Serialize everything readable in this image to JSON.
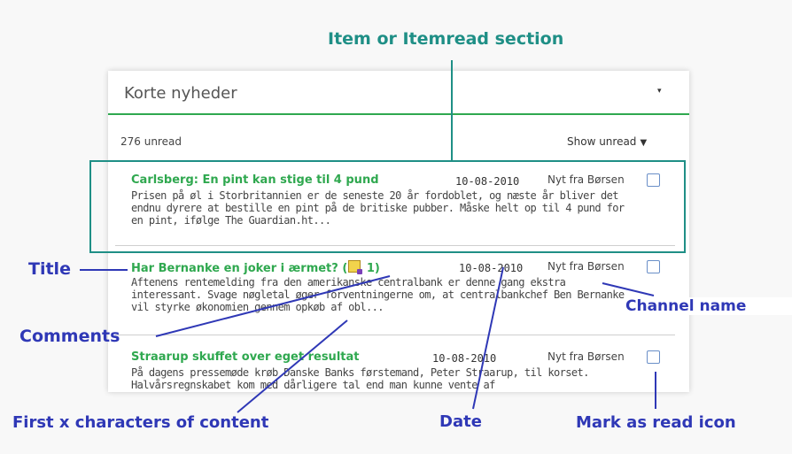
{
  "feed": {
    "title": "Korte nyheder",
    "caret": "▾",
    "unread_count": "276 unread",
    "show_unread": "Show unread",
    "show_unread_caret": "▼"
  },
  "items": [
    {
      "title": "Carlsberg: En pint kan stige til 4 pund",
      "date": "10-08-2010",
      "channel": "Nyt fra Børsen",
      "text": "Prisen på øl i Storbritannien er de seneste 20 år fordoblet, og næste år bliver det endnu dyrere at bestille en pint på de britiske pubber. Måske helt op til 4 pund for en pint, ifølge The Guardian.ht..."
    },
    {
      "title": "Har Bernanke en joker i ærmet?",
      "comment_open": "(",
      "comment_count": "1)",
      "date": "10-08-2010",
      "channel": "Nyt fra Børsen",
      "text": "Aftenens rentemelding fra den amerikanske centralbank er denne gang ekstra interessant. Svage nøgletal øger forventningerne om, at centralbankchef Ben Bernanke vil styrke økonomien gennem opkøb af obl..."
    },
    {
      "title": "Straarup skuffet over eget resultat",
      "date": "10-08-2010",
      "channel": "Nyt fra Børsen",
      "text": "På dagens pressemøde krøb Danske Banks førstemand, Peter Straarup, til korset. Halvårsregnskabet kom med dårligere tal end man kunne vente af"
    }
  ],
  "annotations": {
    "item_section": "Item or Itemread section",
    "title": "Title",
    "comments": "Comments",
    "channel_name": "Channel name",
    "first_chars": "First x characters of content",
    "date": "Date",
    "mark_as_read": "Mark as read icon"
  },
  "colors": {
    "title_green": "#2fa84f",
    "annotation_blue": "#2f38b6",
    "section_teal": "#1f8f86"
  },
  "icons": {
    "comment": "comment-speech-icon",
    "mark_as_read": "checkbox-icon",
    "dropdown": "chevron-down-icon"
  }
}
